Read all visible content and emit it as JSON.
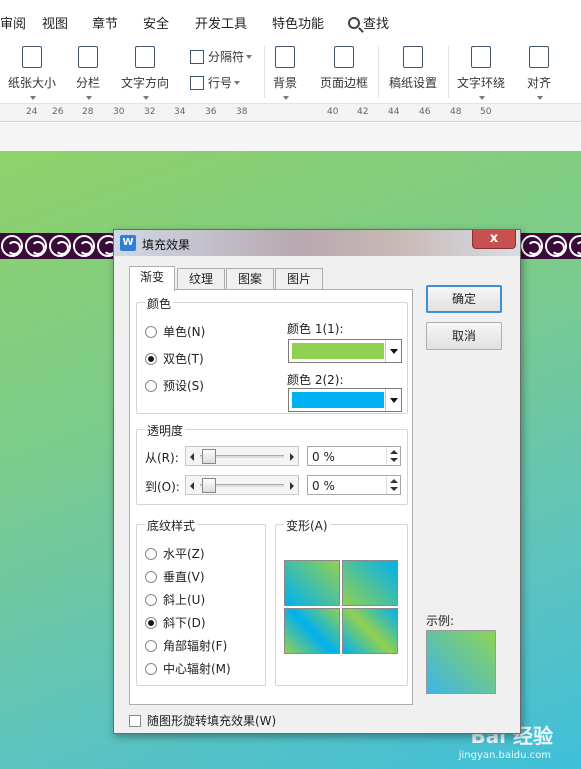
{
  "menu": {
    "items": [
      "审阅",
      "视图",
      "章节",
      "安全",
      "开发工具",
      "特色功能",
      "查找"
    ]
  },
  "ribbon": {
    "paper_size": "纸张大小",
    "columns": "分栏",
    "text_direction": "文字方向",
    "separator": "分隔符",
    "line_number": "行号",
    "background": "背景",
    "page_border": "页面边框",
    "manuscript": "稿纸设置",
    "wrap": "文字环绕",
    "align": "对齐"
  },
  "ruler": {
    "ticks": [
      "24",
      "26",
      "28",
      "30",
      "32",
      "34",
      "36",
      "38",
      "40",
      "42",
      "44",
      "46",
      "48",
      "50"
    ]
  },
  "dialog": {
    "title": "填充效果",
    "close": "x",
    "tabs": [
      "渐变",
      "纹理",
      "图案",
      "图片"
    ],
    "color_group": "颜色",
    "radio_single": "单色(N)",
    "radio_double": "双色(T)",
    "radio_preset": "预设(S)",
    "color1_label": "颜色 1(1):",
    "color2_label": "颜色 2(2):",
    "transparency_group": "透明度",
    "from_label": "从(R):",
    "to_label": "到(O):",
    "from_value": "0 %",
    "to_value": "0 %",
    "shading_group": "底纹样式",
    "shading_styles": [
      "水平(Z)",
      "垂直(V)",
      "斜上(U)",
      "斜下(D)",
      "角部辐射(F)",
      "中心辐射(M)"
    ],
    "variant_group": "变形(A)",
    "rotate_label": "随图形旋转填充效果(W)",
    "ok": "确定",
    "cancel": "取消",
    "sample_label": "示例:"
  },
  "colors": {
    "color1": "#92d050",
    "color2": "#00b0f0"
  },
  "watermark": {
    "brand": "Bai 经验",
    "url": "jingyan.baidu.com"
  }
}
